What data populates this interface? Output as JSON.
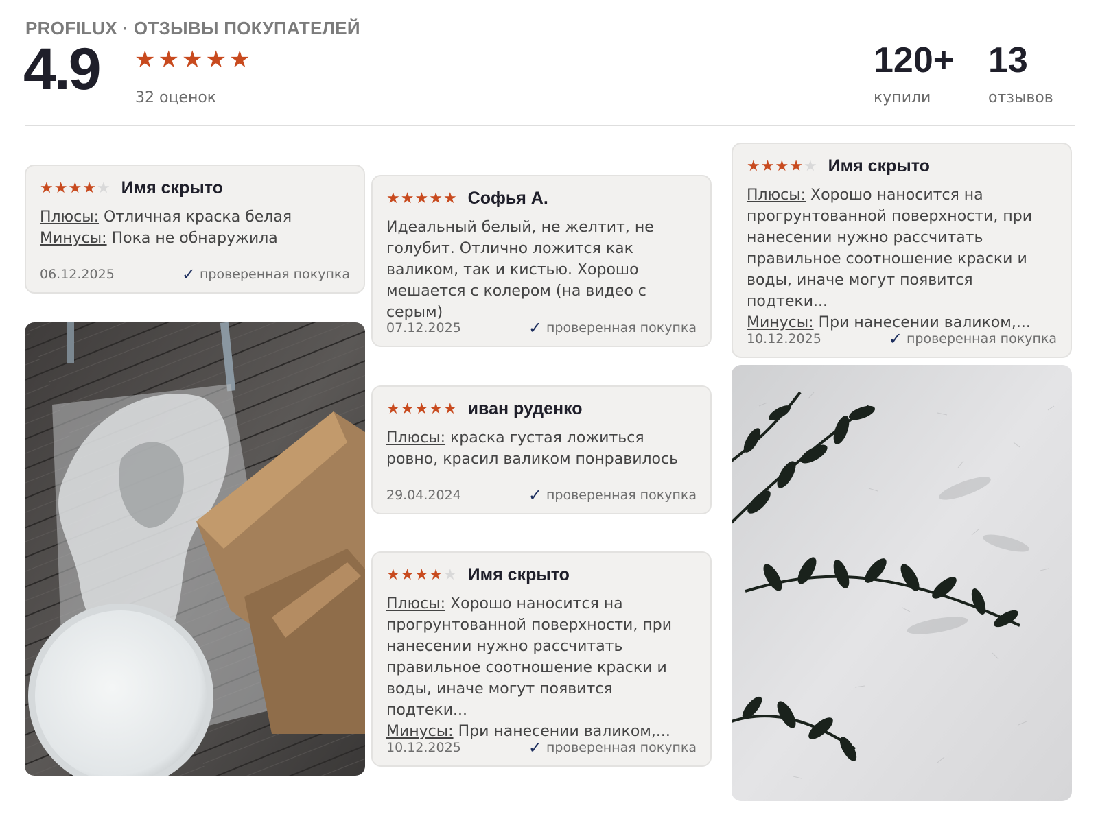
{
  "header": {
    "brand": "PROFILUX · ОТЗЫВЫ ПОКУПАТЕЛЕЙ",
    "rating": "4.9",
    "stars": 5,
    "ratings_count": "32 оценок",
    "stats": [
      {
        "value": "120+",
        "label": "купили"
      },
      {
        "value": "13",
        "label": "отзывов"
      }
    ]
  },
  "colors": {
    "star": "#c84a1e",
    "star_empty": "#d9d9d9",
    "check": "#1e2f5e",
    "card_bg": "#f2f1ef"
  },
  "verified_label": "проверенная покупка",
  "plus_label": "Плюсы:",
  "minus_label": "Минусы:",
  "reviews": [
    {
      "author": "Имя скрыто",
      "rating": 4,
      "plus": "Отличная краска белая",
      "minus": "Пока не обнаружила",
      "date": "06.12.2025"
    },
    {
      "author": "Софья А.",
      "rating": 5,
      "text": "Идеальный белый, не желтит, не голубит. Отлично ложится как валиком, так и кистью. Хорошо мешается с колером (на видео с серым)",
      "date": "07.12.2025"
    },
    {
      "author": "иван руденко",
      "rating": 5,
      "plus": "краска густая ложиться ровно, красил валиком понравилось",
      "date": "29.04.2024"
    },
    {
      "author": "Имя скрыто",
      "rating": 4,
      "plus": "Хорошо наносится на прогрунтованной поверхности, при нанесении нужно рассчитать правильное соотношение краски и воды, иначе могут появится подтеки...",
      "minus": "При нанесении валиком,...",
      "date": "10.12.2025"
    },
    {
      "author": "Имя скрыто",
      "rating": 4,
      "plus": "Хорошо наносится на прогрунтованной поверхности, при нанесении нужно рассчитать правильное соотношение краски и воды, иначе могут появится подтеки...",
      "minus": "При нанесении валиком,...",
      "date": "10.12.2025"
    }
  ],
  "photos": [
    {
      "name": "paint-bucket-unboxing-photo"
    },
    {
      "name": "textured-wall-plant-photo"
    }
  ]
}
